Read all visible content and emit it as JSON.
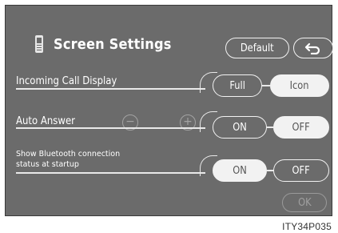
{
  "window": {
    "title": "Screen Settings",
    "default_label": "Default"
  },
  "rows": {
    "incoming": {
      "label": "Incoming Call Display",
      "options": [
        "Full",
        "Icon"
      ],
      "selected": "Icon"
    },
    "auto_answer": {
      "label": "Auto Answer",
      "decrease_symbol": "−",
      "increase_symbol": "+",
      "options": [
        "ON",
        "OFF"
      ],
      "selected": "OFF"
    },
    "bluetooth": {
      "label_line1": "Show Bluetooth connection",
      "label_line2": "status at startup",
      "options": [
        "ON",
        "OFF"
      ],
      "selected": "ON"
    }
  },
  "footer": {
    "ok_label": "OK",
    "ok_enabled": false
  },
  "figure_caption": "ITY34P035",
  "icons": {
    "title": "phone-icon",
    "back": "back-arrow-icon"
  },
  "colors": {
    "screen_background": "#6b6b6b",
    "selected_fill": "#f2f2f2",
    "disabled": "#9a9a9a"
  }
}
